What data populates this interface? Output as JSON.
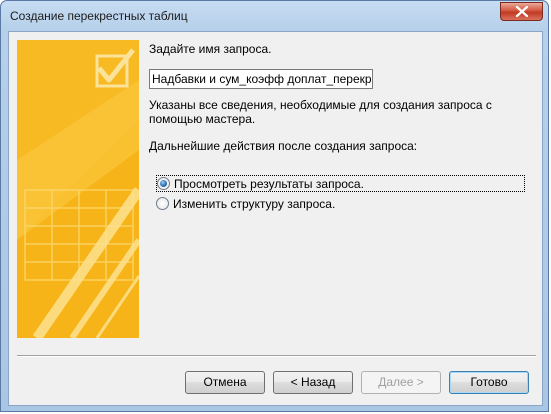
{
  "window": {
    "title": "Создание перекрестных таблиц"
  },
  "form": {
    "prompt_label": "Задайте имя запроса.",
    "query_name": "Надбавки и сум_коэфф доплат_перекрестн",
    "info_text": "Указаны все сведения, необходимые для создания запроса с помощью мастера.",
    "next_steps_label": "Дальнейшие действия после создания запроса:",
    "options": [
      {
        "label": "Просмотреть результаты запроса.",
        "checked": true
      },
      {
        "label": "Изменить структуру запроса.",
        "checked": false
      }
    ]
  },
  "buttons": {
    "cancel": "Отмена",
    "back": "< Назад",
    "next": "Далее >",
    "finish": "Готово"
  },
  "colors": {
    "banner": "#f6b418",
    "title_bar": "#b6d0ea",
    "close": "#c23a23"
  }
}
